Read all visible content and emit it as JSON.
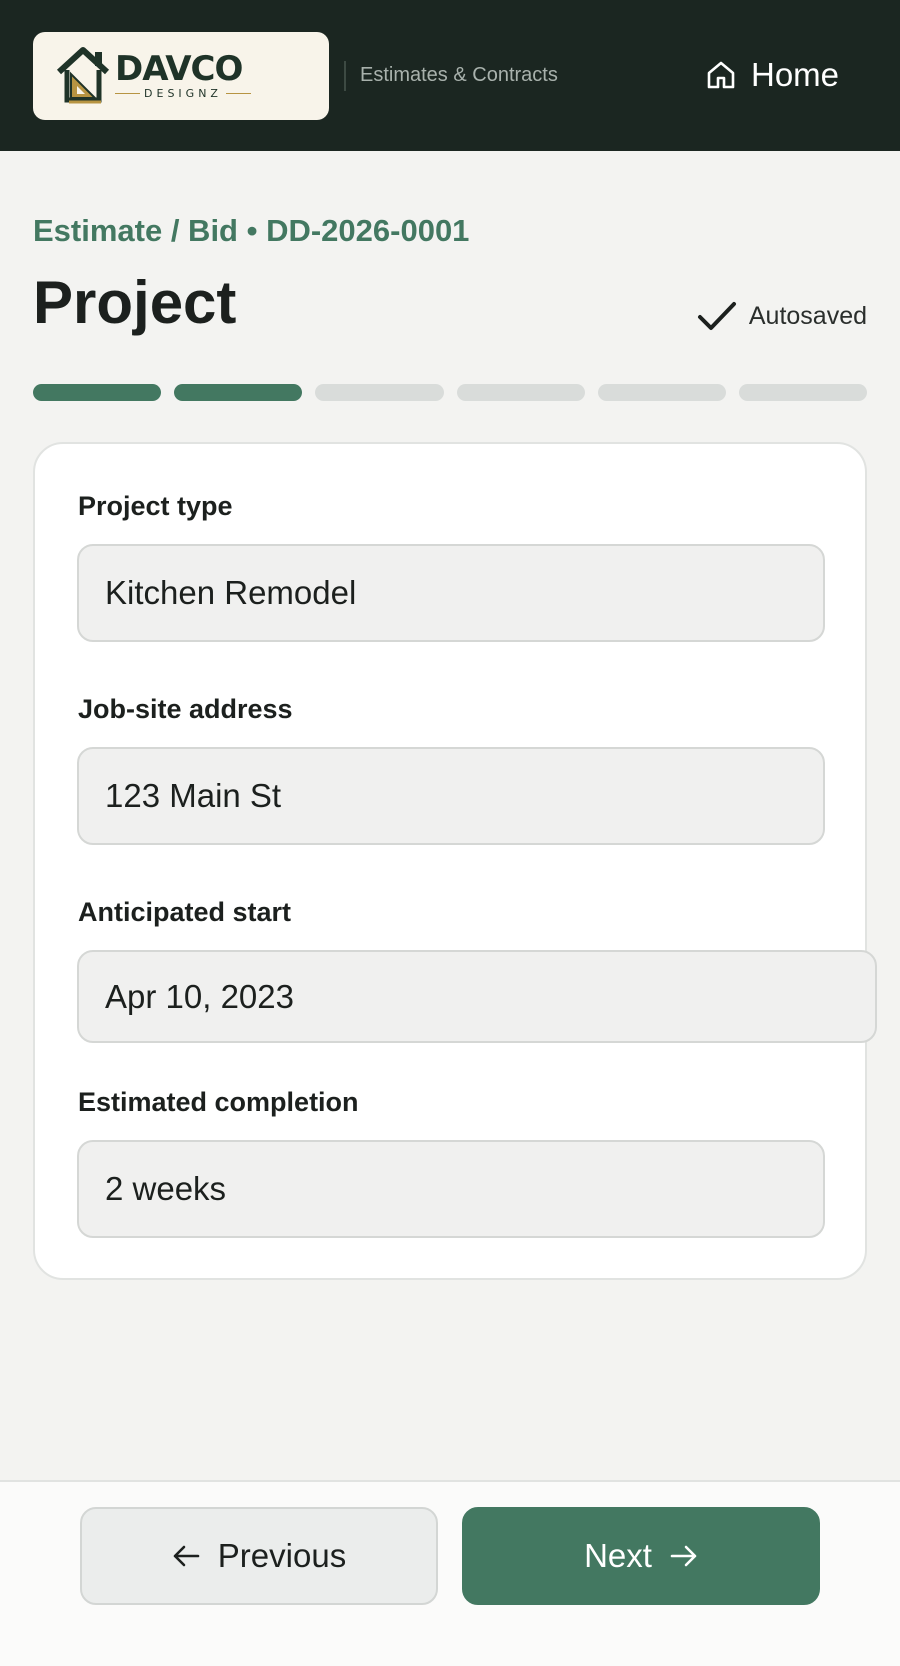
{
  "header": {
    "logo": {
      "wordmark": "DAVCO",
      "subword": "DESIGNZ"
    },
    "subtitle": "Estimates & Contracts",
    "home_label": "Home"
  },
  "page": {
    "breadcrumb": "Estimate / Bid • DD-2026-0001",
    "title": "Project",
    "autosave_status": "Autosaved"
  },
  "stepper": {
    "total_steps": 6,
    "completed_steps": 2
  },
  "form": {
    "fields": [
      {
        "label": "Project type",
        "value": "Kitchen Remodel"
      },
      {
        "label": "Job-site address",
        "value": "123 Main St"
      },
      {
        "label": "Anticipated start",
        "value": "Apr 10, 2023"
      },
      {
        "label": "Estimated completion",
        "value": "2 weeks"
      }
    ]
  },
  "footer": {
    "previous_label": "Previous",
    "next_label": "Next"
  },
  "colors": {
    "header_bg": "#1b2621",
    "accent": "#437861",
    "page_bg": "#f3f3f1",
    "logo_gold": "#b79442"
  },
  "icons": {
    "home": "home-icon",
    "check": "check-icon",
    "arrow_left": "arrow-left-icon",
    "arrow_right": "arrow-right-icon"
  }
}
